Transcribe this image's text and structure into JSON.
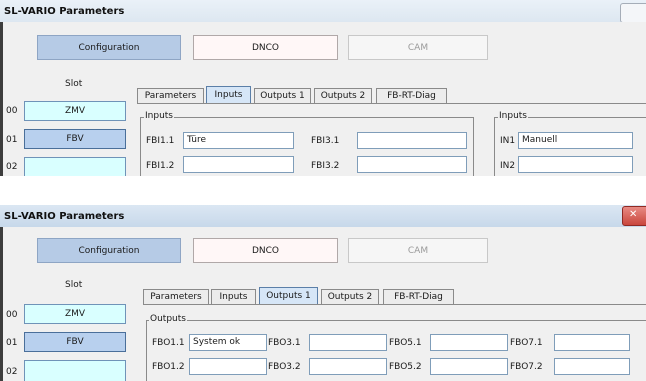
{
  "screen1": {
    "title": "SL-VARIO Parameters",
    "buttons": {
      "configuration": "Configuration",
      "dnco": "DNCO",
      "cam": "CAM"
    },
    "slot": {
      "header": "Slot",
      "rows": [
        {
          "num": "00",
          "label": "ZMV"
        },
        {
          "num": "01",
          "label": "FBV"
        },
        {
          "num": "02",
          "label": ""
        }
      ]
    },
    "tabs": [
      "Parameters",
      "Inputs",
      "Outputs 1",
      "Outputs 2",
      "FB-RT-Diag"
    ],
    "active_tab": "Inputs",
    "group1": {
      "label": "Inputs",
      "fields": [
        {
          "label": "FBI1.1",
          "value": "Türe"
        },
        {
          "label": "FBI1.2",
          "value": ""
        },
        {
          "label": "FBI3.1",
          "value": ""
        },
        {
          "label": "FBI3.2",
          "value": ""
        }
      ]
    },
    "group2": {
      "label": "Inputs",
      "fields": [
        {
          "label": "IN1",
          "value": "Manuell"
        },
        {
          "label": "IN2",
          "value": ""
        }
      ]
    }
  },
  "screen2": {
    "title": "SL-VARIO Parameters",
    "buttons": {
      "configuration": "Configuration",
      "dnco": "DNCO",
      "cam": "CAM"
    },
    "slot": {
      "header": "Slot",
      "rows": [
        {
          "num": "00",
          "label": "ZMV"
        },
        {
          "num": "01",
          "label": "FBV"
        },
        {
          "num": "02",
          "label": ""
        }
      ]
    },
    "tabs": [
      "Parameters",
      "Inputs",
      "Outputs 1",
      "Outputs 2",
      "FB-RT-Diag"
    ],
    "active_tab": "Outputs 1",
    "group": {
      "label": "Outputs",
      "fields": [
        {
          "label": "FBO1.1",
          "value": "System ok"
        },
        {
          "label": "FBO1.2",
          "value": ""
        },
        {
          "label": "FBO3.1",
          "value": ""
        },
        {
          "label": "FBO3.2",
          "value": ""
        },
        {
          "label": "FBO5.1",
          "value": ""
        },
        {
          "label": "FBO5.2",
          "value": ""
        },
        {
          "label": "FBO7.1",
          "value": ""
        },
        {
          "label": "FBO7.2",
          "value": ""
        }
      ]
    }
  },
  "colors": {
    "selected_button": "#b6cbe6",
    "slot_selected": "#b8d0ee",
    "slot_empty": "#d9ffff",
    "active_tab": "#d6e6f7",
    "close_button": "#c9463d"
  },
  "icons": {
    "close": "close-icon"
  }
}
